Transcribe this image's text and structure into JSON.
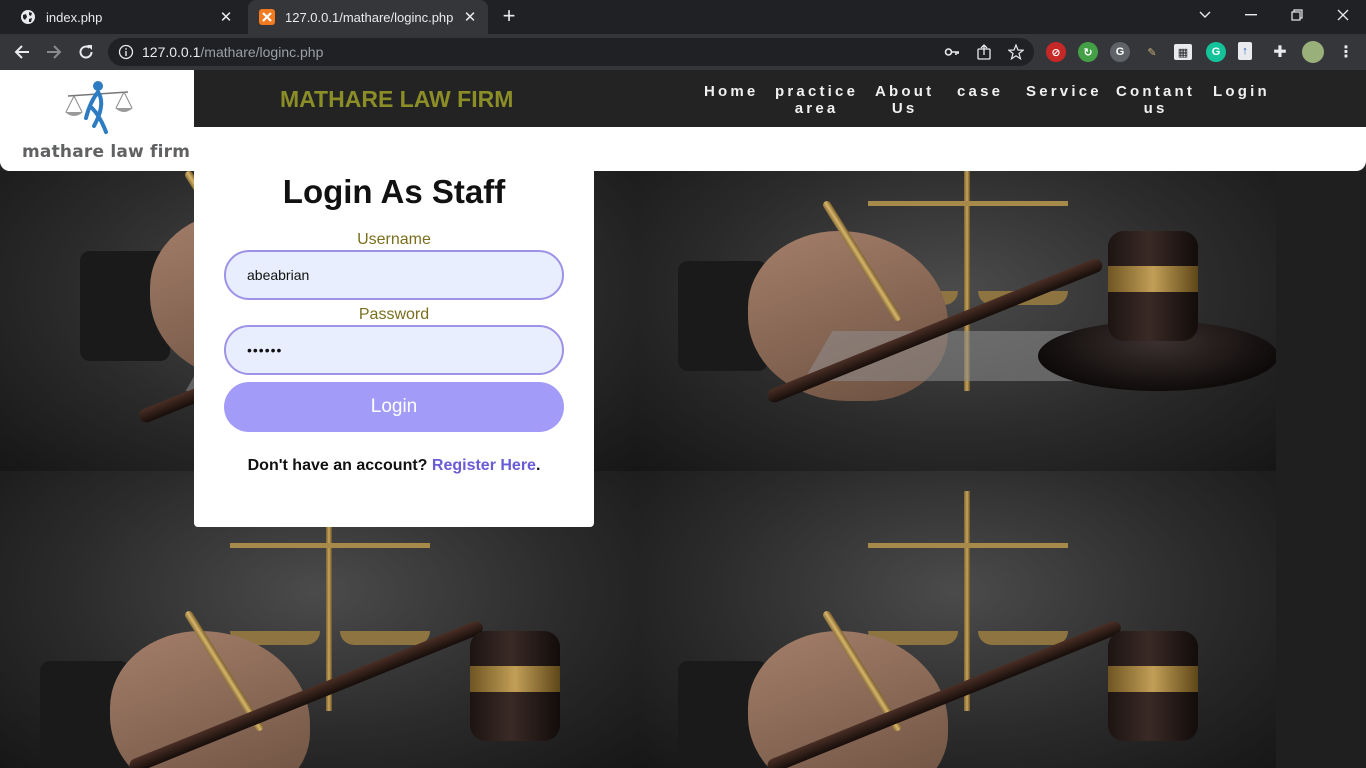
{
  "browser": {
    "tabs": [
      {
        "title": "index.php",
        "active": false
      },
      {
        "title": "127.0.0.1/mathare/loginc.php",
        "active": true
      }
    ],
    "new_tab": "+",
    "url_host": "127.0.0.1",
    "url_path": "/mathare/loginc.php"
  },
  "site": {
    "logo_text": "mathare law firm",
    "brand": "MATHARE LAW FIRM",
    "brand_color": "#8b8d27",
    "nav": [
      {
        "line1": "Home",
        "line2": ""
      },
      {
        "line1": "practice",
        "line2": "area"
      },
      {
        "line1": "About",
        "line2": "Us"
      },
      {
        "line1": "case",
        "line2": ""
      },
      {
        "line1": "Service",
        "line2": ""
      },
      {
        "line1": "Contant",
        "line2": "us"
      },
      {
        "line1": "Login",
        "line2": ""
      }
    ]
  },
  "login": {
    "title": "Login As Staff",
    "username_label": "Username",
    "username_value": "abeabrian",
    "password_label": "Password",
    "password_value": "••••••",
    "button": "Login",
    "register_prompt": "Don't have an account?",
    "register_link": "Register Here",
    "register_end": ".",
    "accent": "#a39bf8"
  }
}
